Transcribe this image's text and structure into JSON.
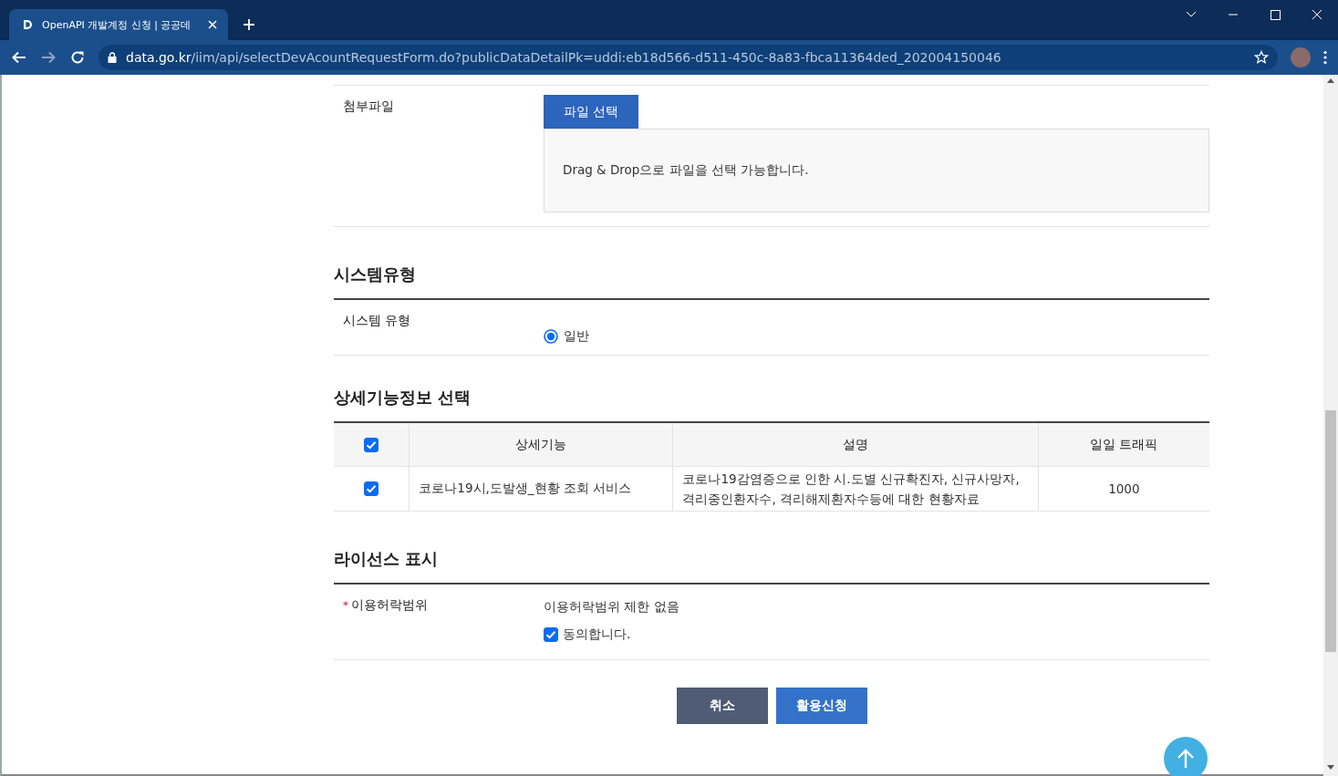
{
  "browser": {
    "tab_title": "OpenAPI 개발계정 신청 | 공공데",
    "url_domain": "data.go.kr",
    "url_path": "/iim/api/selectDevAcountRequestForm.do?publicDataDetailPk=uddi:eb18d566-d511-450c-8a83-fbca11364ded_202004150046"
  },
  "attachment": {
    "label": "첨부파일",
    "button": "파일 선택",
    "dropzone_text": "Drag & Drop으로 파일을 선택 가능합니다."
  },
  "system_type": {
    "heading": "시스템유형",
    "label": "시스템 유형",
    "options": [
      {
        "label": "일반",
        "selected": true
      }
    ]
  },
  "detail_features": {
    "heading": "상세기능정보 선택",
    "select_all_checked": true,
    "columns": [
      "상세기능",
      "설명",
      "일일 트래픽"
    ],
    "rows": [
      {
        "checked": true,
        "feature": "코로나19시,도발생_현황 조회 서비스",
        "description": "코로나19감염증으로 인한 시.도별 신규확진자, 신규사망자, 격리중인환자수, 격리해제환자수등에 대한 현황자료",
        "traffic": "1000"
      }
    ]
  },
  "license": {
    "heading": "라이선스 표시",
    "required_mark": "*",
    "label": "이용허락범위",
    "value": "이용허락범위 제한 없음",
    "agree_label": "동의합니다.",
    "agree_checked": true
  },
  "buttons": [
    {
      "kind": "secondary",
      "label": "취소"
    },
    {
      "kind": "primary",
      "label": "활용신청"
    }
  ]
}
